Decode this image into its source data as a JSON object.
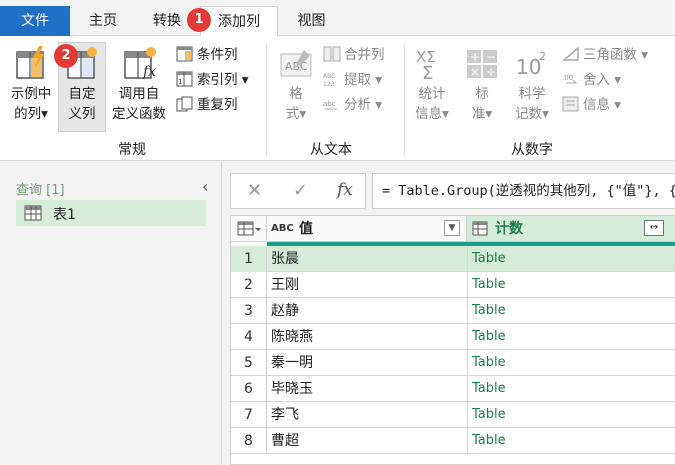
{
  "tabs": {
    "file": "文件",
    "home": "主页",
    "transform": "转换",
    "add_column": "添加列",
    "view": "视图",
    "badge1": "1",
    "badge2": "2"
  },
  "ribbon": {
    "general": {
      "example_col_l1": "示例中",
      "example_col_l2": "的列",
      "custom_col_l1": "自定",
      "custom_col_l2": "义列",
      "invoke_fn_l1": "调用自",
      "invoke_fn_l2": "定义函数",
      "conditional_col": "条件列",
      "index_col": "索引列",
      "duplicate_col": "重复列",
      "group_label": "常规"
    },
    "from_text": {
      "format_l1": "格",
      "format_l2": "式",
      "merge_cols": "合并列",
      "extract": "提取",
      "parse": "分析",
      "group_label": "从文本",
      "abc_icon_text": "ABC",
      "abc123_text": "ABC\n123"
    },
    "from_number": {
      "stats_l1": "统计",
      "stats_l2": "信息",
      "standard_l1": "标",
      "standard_l2": "准",
      "scientific_l1": "科学",
      "scientific_l2": "记数",
      "trig": "三角函数",
      "rounding": "舍入",
      "info": "信息",
      "group_label": "从数字",
      "sigma_text": "XΣ",
      "ten_text": "10",
      "sup_text": "2",
      "dec_text": ".00"
    }
  },
  "queries": {
    "title": "查询 [1]",
    "items": [
      "表1"
    ]
  },
  "formula": {
    "cancel": "✕",
    "confirm": "✓",
    "fx": "fx",
    "expression": "= Table.Group(逆透视的其他列, {\"值\"}, {{\"计数\", each _, type table"
  },
  "grid": {
    "col1_type": "ABC",
    "col1_name": "值",
    "col2_name": "计数",
    "rows": [
      {
        "num": "1",
        "value": "张晨",
        "count": "Table"
      },
      {
        "num": "2",
        "value": "王刚",
        "count": "Table"
      },
      {
        "num": "3",
        "value": "赵静",
        "count": "Table"
      },
      {
        "num": "4",
        "value": "陈晓燕",
        "count": "Table"
      },
      {
        "num": "5",
        "value": "秦一明",
        "count": "Table"
      },
      {
        "num": "6",
        "value": "毕晓玉",
        "count": "Table"
      },
      {
        "num": "7",
        "value": "李飞",
        "count": "Table"
      },
      {
        "num": "8",
        "value": "曹超",
        "count": "Table"
      }
    ]
  },
  "colors": {
    "file_tab": "#1f6fc7",
    "selection": "#d6ecd8",
    "badge": "#e53935",
    "accent_line": "#1a9c8c"
  }
}
